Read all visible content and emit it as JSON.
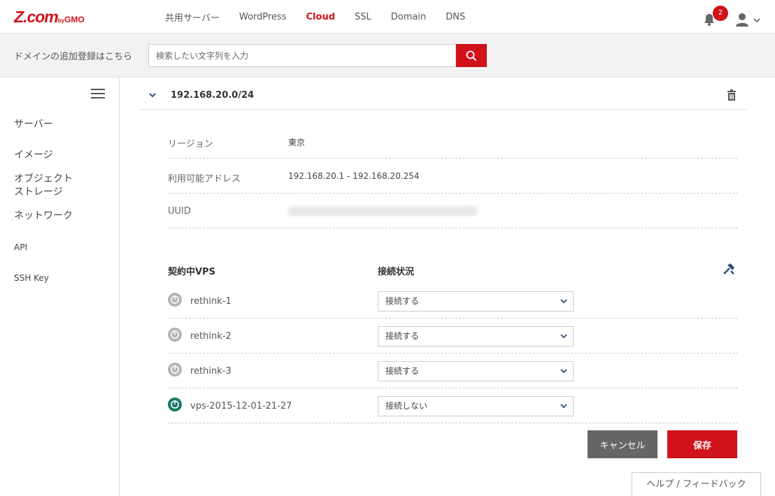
{
  "header": {
    "logo_main": "Z.com",
    "logo_by": "by",
    "logo_gmo": "GMO",
    "nav": [
      "共用サーバー",
      "WordPress",
      "Cloud",
      "SSL",
      "Domain",
      "DNS"
    ],
    "active_nav": "Cloud",
    "notification_count": "2",
    "accent_color": "#d0121b"
  },
  "search": {
    "label": "ドメインの追加登録はこちら",
    "placeholder": "検索したい文字列を入力"
  },
  "sidebar": {
    "items": [
      "サーバー",
      "イメージ",
      "オブジェクト",
      "ストレージ",
      "ネットワーク",
      "API",
      "SSH Key"
    ]
  },
  "network": {
    "title": "192.168.20.0/24",
    "info": [
      {
        "label": "リージョン",
        "value": "東京"
      },
      {
        "label": "利用可能アドレス",
        "value": "192.168.20.1 - 192.168.20.254"
      },
      {
        "label": "UUID",
        "value": ""
      }
    ]
  },
  "vps_table": {
    "col_vps": "契約中VPS",
    "col_status": "接続状況",
    "rows": [
      {
        "name": "rethink-1",
        "status": "接続する",
        "power": "off"
      },
      {
        "name": "rethink-2",
        "status": "接続する",
        "power": "off"
      },
      {
        "name": "rethink-3",
        "status": "接続する",
        "power": "off"
      },
      {
        "name": "vps-2015-12-01-21-27",
        "status": "接続しない",
        "power": "on"
      }
    ]
  },
  "actions": {
    "cancel": "キャンセル",
    "save": "保存",
    "help": "ヘルプ / フィードバック"
  }
}
